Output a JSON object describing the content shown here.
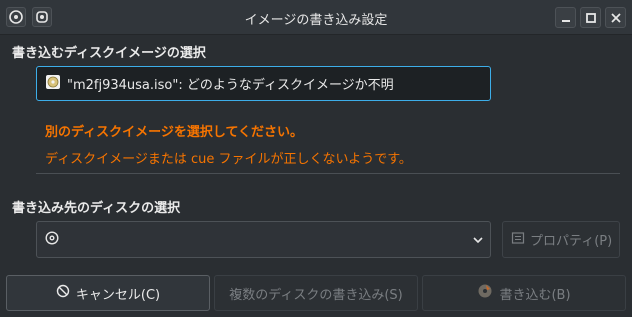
{
  "window": {
    "title": "イメージの書き込み設定",
    "left_icons": [
      "app-disc-icon",
      "pin-icon"
    ],
    "controls": [
      "minimize-icon",
      "maximize-icon",
      "close-icon"
    ]
  },
  "image_section": {
    "label": "書き込むディスクイメージの選択",
    "field_icon": "disc-file-icon",
    "field_text": "\"m2fj934usa.iso\": どのようなディスクイメージか不明",
    "error_title": "別のディスクイメージを選択してください。",
    "error_detail": "ディスクイメージまたは cue ファイルが正しくないようです。",
    "error_color": "#f67400"
  },
  "target_section": {
    "label": "書き込み先のディスクの選択",
    "combo_icon": "optical-disc-icon",
    "combo_value": "",
    "properties_label": "プロパティ(P)",
    "properties_icon": "properties-icon"
  },
  "buttons": {
    "cancel_label": "キャンセル(C)",
    "cancel_icon": "cancel-icon",
    "multi_label": "複数のディスクの書き込み(S)",
    "burn_label": "書き込む(B)",
    "burn_icon": "burn-disc-icon"
  },
  "accent_color": "#3daee9"
}
